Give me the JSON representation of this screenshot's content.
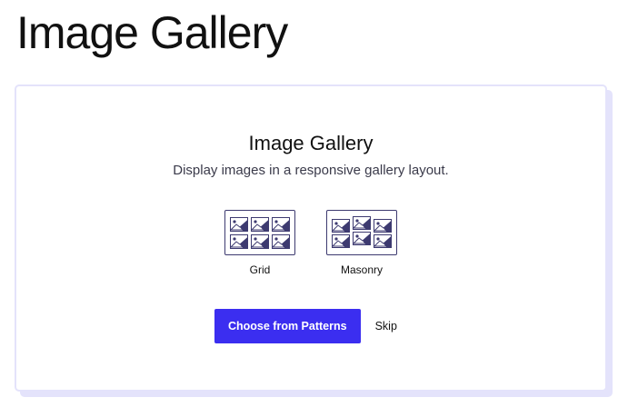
{
  "page": {
    "title": "Image Gallery"
  },
  "placeholder": {
    "title": "Image Gallery",
    "description": "Display images in a responsive gallery layout.",
    "variations": [
      {
        "label": "Grid",
        "icon": "image-grid-icon"
      },
      {
        "label": "Masonry",
        "icon": "image-masonry-icon"
      }
    ],
    "actions": {
      "primary_label": "Choose from Patterns",
      "skip_label": "Skip"
    }
  },
  "colors": {
    "accent": "#3b2ef0",
    "card_border": "#e4e3fb",
    "icon_stroke": "#3d3a70"
  }
}
